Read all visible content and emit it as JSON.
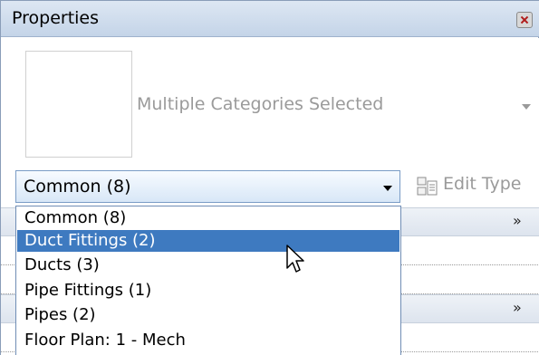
{
  "panel": {
    "title": "Properties",
    "close_icon": "close-icon"
  },
  "type_selector": {
    "label": "Multiple Categories Selected",
    "arrow_icon": "chevron-down-icon"
  },
  "filter": {
    "value": "Common (8)",
    "arrow_icon": "chevron-down-icon",
    "edit_type_label": "Edit Type",
    "edit_type_icon": "edit-type-icon"
  },
  "dropdown": {
    "items": [
      {
        "label": "Common (8)",
        "selected": false
      },
      {
        "label": "Duct Fittings (2)",
        "selected": true
      },
      {
        "label": "Ducts (3)",
        "selected": false
      },
      {
        "label": "Pipe Fittings (1)",
        "selected": false
      },
      {
        "label": "Pipes (2)",
        "selected": false
      },
      {
        "label": "Floor Plan: 1 - Mech",
        "selected": false
      }
    ]
  },
  "grid": {
    "group_collapse_symbol": "»"
  },
  "colors": {
    "selection": "#3e7ac0",
    "title_bar": "#c4d4e8",
    "disabled_text": "#9a9a9a"
  }
}
